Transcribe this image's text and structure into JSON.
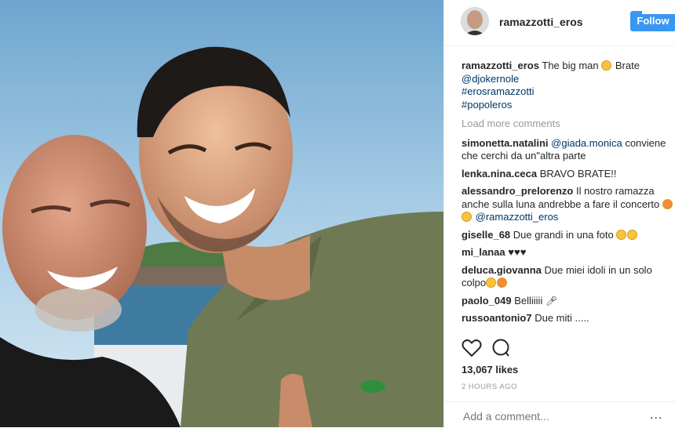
{
  "post": {
    "username": "ramazzotti_eros",
    "follow_label": "Follow"
  },
  "caption": {
    "username": "ramazzotti_eros",
    "text": "The big man",
    "text2": "Brate",
    "mention": "@djokernole",
    "tags": [
      "#erosramazzotti",
      "#popoleros"
    ]
  },
  "load_more": "Load more comments",
  "comments": [
    {
      "user": "simonetta.natalini",
      "mention": "@giada.monica",
      "text": "conviene che cerchi da un\"altra parte"
    },
    {
      "user": "lenka.nina.ceca",
      "text": "BRAVO BRATE!!"
    },
    {
      "user": "alessandro_prelorenzo",
      "text": "Il nostro ramazza anche sulla luna andrebbe a fare il concerto",
      "mention": "@ramazzotti_eros"
    },
    {
      "user": "giselle_68",
      "text": "Due grandi in una foto"
    },
    {
      "user": "mi_lanaa",
      "text": "♥♥♥"
    },
    {
      "user": "deluca.giovanna",
      "text": "Due miei idoli in un solo colpo"
    },
    {
      "user": "paolo_049",
      "text": "Belliiiii"
    },
    {
      "user": "russoantonio7",
      "text": "Due miti ....."
    }
  ],
  "likes": "13,067 likes",
  "time": "2 HOURS AGO",
  "add_comment_placeholder": "Add a comment...",
  "more_options": "...",
  "colors": {
    "follow": "#3897f0",
    "link": "#003569",
    "muted": "#999999"
  }
}
